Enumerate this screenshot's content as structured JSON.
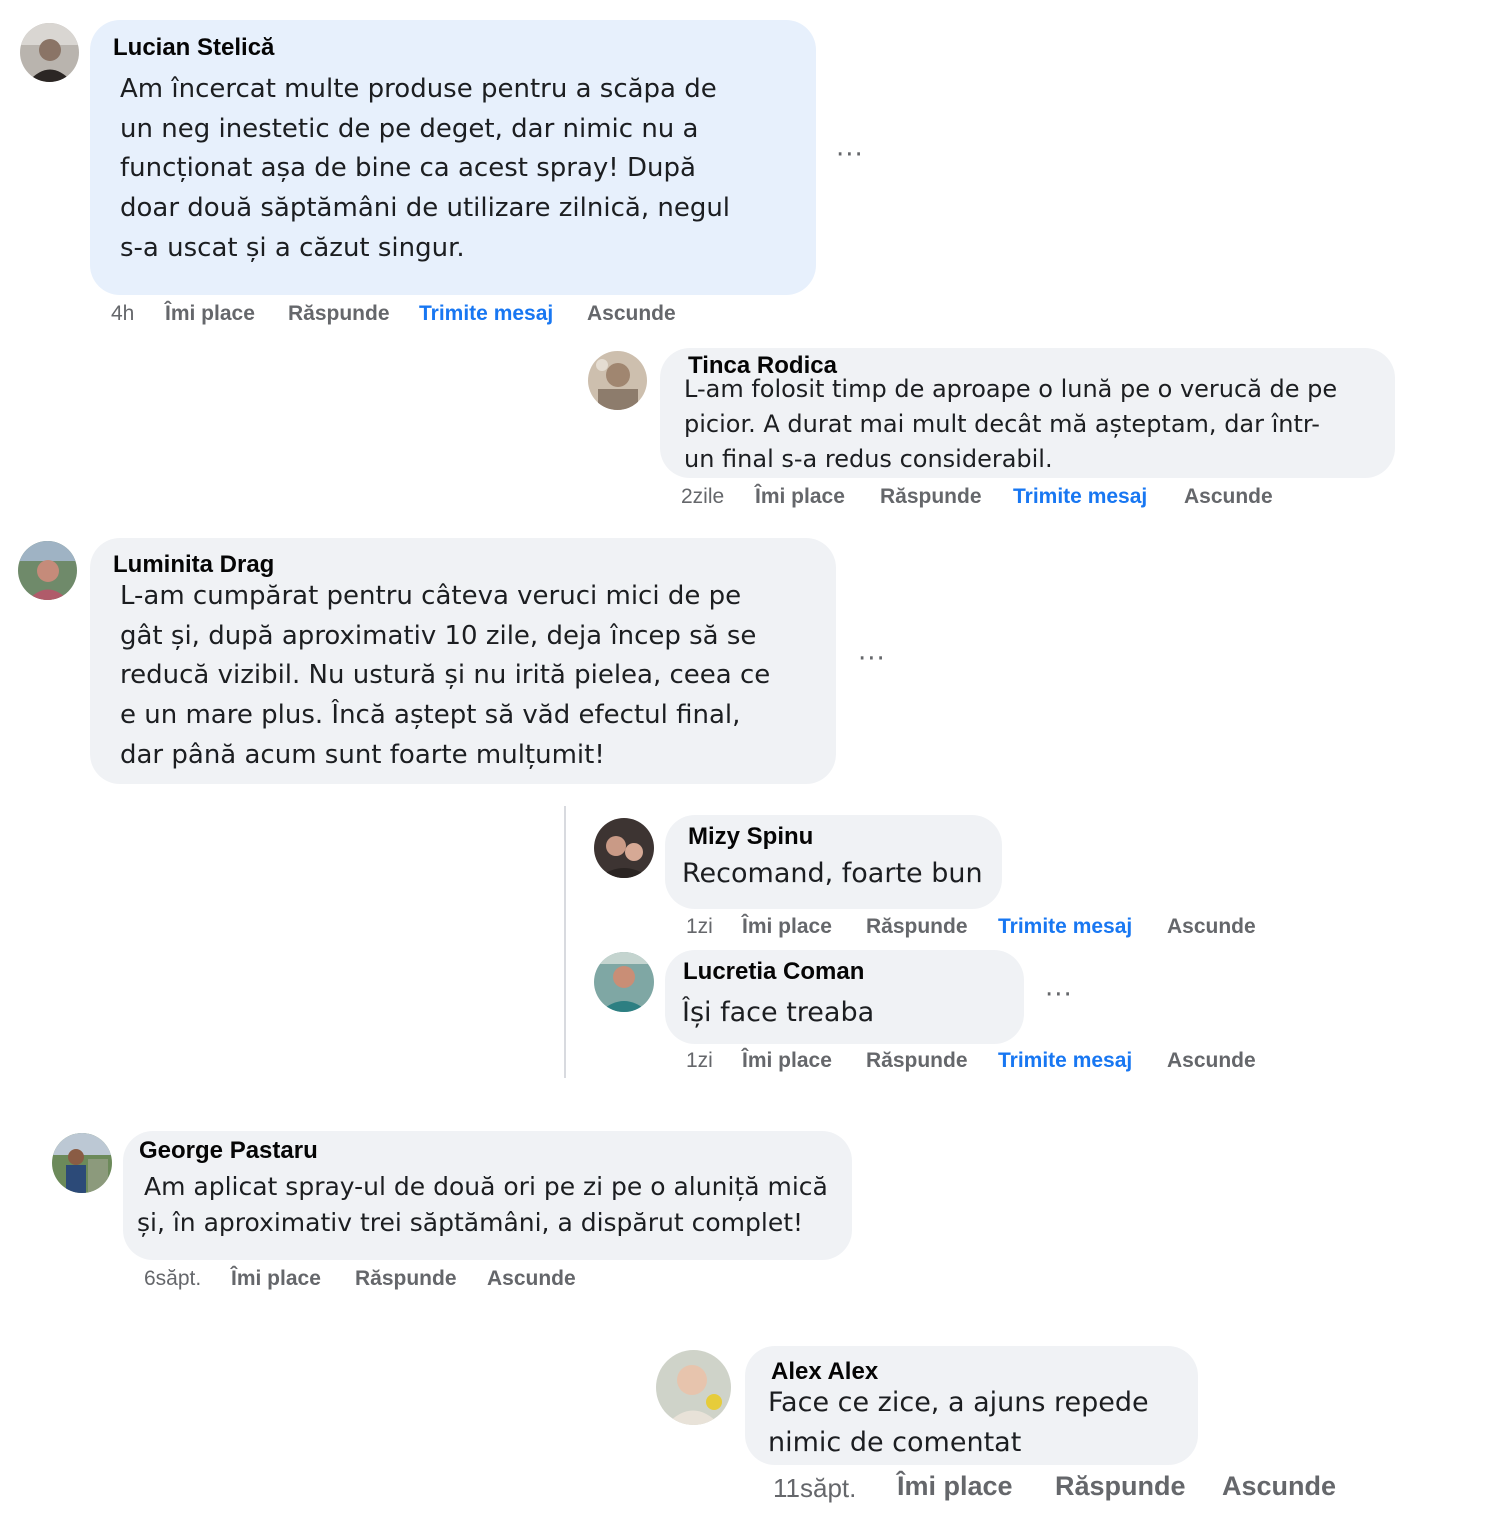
{
  "comments": [
    {
      "author": "Lucian Stelică",
      "lines": [
        "Am încercat multe produse pentru a scăpa de",
        "un neg inestetic de pe deget, dar nimic nu a",
        "funcționat așa de bine ca acest spray! După",
        "doar două săptămâni de utilizare zilnică, negul",
        "s-a uscat și a căzut singur."
      ],
      "time": "4h",
      "actions": [
        "Îmi place",
        "Răspunde",
        "Trimite mesaj",
        "Ascunde"
      ],
      "more": "···"
    },
    {
      "author": "Tinca Rodica",
      "lines": [
        "L-am folosit timp de aproape o lună pe o verucă de pe",
        "picior. A durat mai mult decât mă așteptam, dar într-",
        "un final s-a redus considerabil."
      ],
      "time": "2zile",
      "actions": [
        "Îmi place",
        "Răspunde",
        "Trimite mesaj",
        "Ascunde"
      ]
    },
    {
      "author": "Luminita Drag",
      "lines": [
        "L-am cumpărat pentru câteva veruci mici de pe",
        "gât și, după aproximativ 10 zile, deja încep să se",
        "reducă vizibil. Nu ustură și nu irită pielea, ceea ce",
        "e un mare plus. Încă aștept să văd efectul final,",
        "dar până acum sunt foarte mulțumit!"
      ],
      "more": "···"
    },
    {
      "author": "Mizy Spinu",
      "lines": [
        "Recomand, foarte bun"
      ],
      "time": "1zi",
      "actions": [
        "Îmi place",
        "Răspunde",
        "Trimite mesaj",
        "Ascunde"
      ]
    },
    {
      "author": "Lucretia Coman",
      "lines": [
        "Își face treaba"
      ],
      "time": "1zi",
      "actions": [
        "Îmi place",
        "Răspunde",
        "Trimite mesaj",
        "Ascunde"
      ],
      "more": "···"
    },
    {
      "author": "George Pastaru",
      "lines": [
        "Am aplicat spray-ul de două ori pe zi pe o aluniță mică",
        "și, în aproximativ trei săptămâni, a dispărut complet!"
      ],
      "time": "6săpt.",
      "actions": [
        "Îmi place",
        "Răspunde",
        "Ascunde"
      ]
    },
    {
      "author": "Alex Alex",
      "lines": [
        "Face ce zice, a ajuns repede",
        "nimic de comentat"
      ],
      "time": "11săpt.",
      "actions": [
        "Îmi place",
        "Răspunde",
        "Ascunde"
      ]
    }
  ],
  "colors": {
    "link_blue": "#1877f2",
    "meta_gray": "#65676b",
    "bubble": "#f0f2f5",
    "bubble_highlight": "#e7f0fc"
  }
}
